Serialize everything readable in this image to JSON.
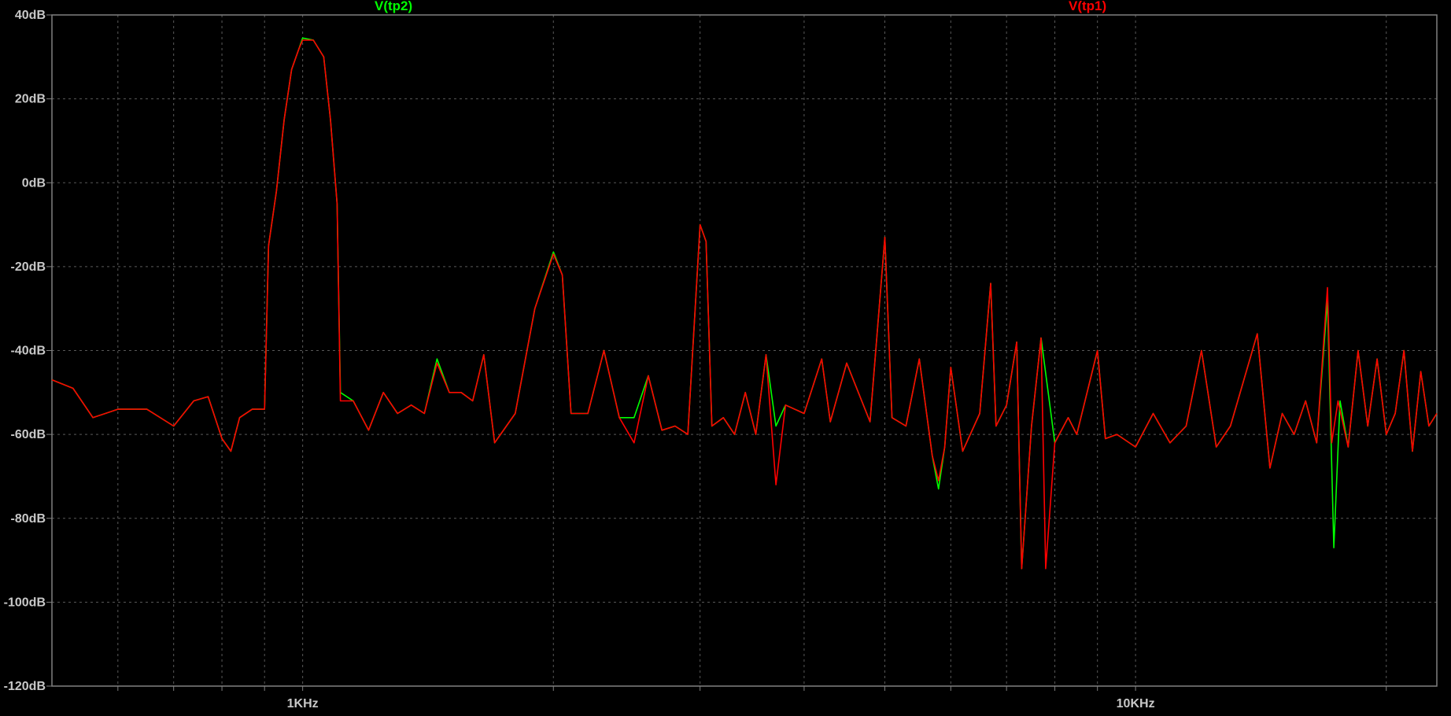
{
  "chart_data": {
    "type": "line",
    "xscale": "log",
    "xlim": [
      500,
      23000
    ],
    "ylim": [
      -120,
      40
    ],
    "grid": true,
    "y_ticks": [
      "40dB",
      "20dB",
      "0dB",
      "-20dB",
      "-40dB",
      "-60dB",
      "-80dB",
      "-100dB",
      "-120dB"
    ],
    "y_tick_values": [
      40,
      20,
      0,
      -20,
      -40,
      -60,
      -80,
      -100,
      -120
    ],
    "x_tick_labels": [
      "1KHz",
      "10KHz"
    ],
    "x_tick_values": [
      1000,
      10000
    ],
    "series": [
      {
        "name": "V(tp2)",
        "color": "#00ff00",
        "points": [
          [
            500,
            -47
          ],
          [
            530,
            -49
          ],
          [
            560,
            -56
          ],
          [
            600,
            -54
          ],
          [
            650,
            -54
          ],
          [
            700,
            -58
          ],
          [
            740,
            -52
          ],
          [
            770,
            -51
          ],
          [
            800,
            -61
          ],
          [
            820,
            -64
          ],
          [
            840,
            -56
          ],
          [
            870,
            -54
          ],
          [
            900,
            -54
          ],
          [
            910,
            -15
          ],
          [
            930,
            -2
          ],
          [
            950,
            15
          ],
          [
            970,
            27
          ],
          [
            990,
            32
          ],
          [
            1000,
            34.5
          ],
          [
            1030,
            34
          ],
          [
            1060,
            30
          ],
          [
            1080,
            15
          ],
          [
            1100,
            -5
          ],
          [
            1110,
            -50
          ],
          [
            1150,
            -52
          ],
          [
            1200,
            -59
          ],
          [
            1250,
            -50
          ],
          [
            1300,
            -55
          ],
          [
            1350,
            -53
          ],
          [
            1400,
            -55
          ],
          [
            1450,
            -42
          ],
          [
            1500,
            -50
          ],
          [
            1550,
            -50
          ],
          [
            1600,
            -52
          ],
          [
            1650,
            -41
          ],
          [
            1700,
            -62
          ],
          [
            1800,
            -55
          ],
          [
            1900,
            -30
          ],
          [
            2000,
            -16.5
          ],
          [
            2050,
            -22
          ],
          [
            2100,
            -55
          ],
          [
            2200,
            -55
          ],
          [
            2300,
            -40
          ],
          [
            2400,
            -56
          ],
          [
            2500,
            -56
          ],
          [
            2600,
            -46
          ],
          [
            2700,
            -59
          ],
          [
            2800,
            -58
          ],
          [
            2900,
            -60
          ],
          [
            3000,
            -10
          ],
          [
            3050,
            -14
          ],
          [
            3100,
            -58
          ],
          [
            3200,
            -56
          ],
          [
            3300,
            -60
          ],
          [
            3400,
            -50
          ],
          [
            3500,
            -60
          ],
          [
            3600,
            -41
          ],
          [
            3700,
            -58
          ],
          [
            3800,
            -53
          ],
          [
            4000,
            -55
          ],
          [
            4200,
            -42
          ],
          [
            4300,
            -57
          ],
          [
            4500,
            -43
          ],
          [
            4800,
            -57
          ],
          [
            5000,
            -13
          ],
          [
            5100,
            -56
          ],
          [
            5300,
            -58
          ],
          [
            5500,
            -42
          ],
          [
            5700,
            -65
          ],
          [
            5800,
            -73
          ],
          [
            5900,
            -63
          ],
          [
            6000,
            -44
          ],
          [
            6200,
            -64
          ],
          [
            6500,
            -55
          ],
          [
            6700,
            -24
          ],
          [
            6800,
            -58
          ],
          [
            7000,
            -53
          ],
          [
            7200,
            -38
          ],
          [
            7300,
            -92
          ],
          [
            7500,
            -58
          ],
          [
            7700,
            -37
          ],
          [
            8000,
            -62
          ],
          [
            8300,
            -56
          ],
          [
            8500,
            -60
          ],
          [
            9000,
            -40
          ],
          [
            9200,
            -61
          ],
          [
            9500,
            -60
          ],
          [
            10000,
            -63
          ],
          [
            10500,
            -55
          ],
          [
            11000,
            -62
          ],
          [
            11500,
            -58
          ],
          [
            12000,
            -40
          ],
          [
            12500,
            -63
          ],
          [
            13000,
            -58
          ],
          [
            14000,
            -36
          ],
          [
            14500,
            -68
          ],
          [
            15000,
            -55
          ],
          [
            15500,
            -60
          ],
          [
            16000,
            -52
          ],
          [
            16500,
            -62
          ],
          [
            17000,
            -28
          ],
          [
            17300,
            -87
          ],
          [
            17600,
            -52
          ],
          [
            18000,
            -63
          ],
          [
            18500,
            -40
          ],
          [
            19000,
            -58
          ],
          [
            19500,
            -42
          ],
          [
            20000,
            -60
          ],
          [
            20500,
            -55
          ],
          [
            21000,
            -40
          ],
          [
            21500,
            -64
          ],
          [
            22000,
            -45
          ],
          [
            22500,
            -58
          ],
          [
            23000,
            -55
          ]
        ]
      },
      {
        "name": "V(tp1)",
        "color": "#ff0000",
        "points": [
          [
            500,
            -47
          ],
          [
            530,
            -49
          ],
          [
            560,
            -56
          ],
          [
            600,
            -54
          ],
          [
            650,
            -54
          ],
          [
            700,
            -58
          ],
          [
            740,
            -52
          ],
          [
            770,
            -51
          ],
          [
            800,
            -61
          ],
          [
            820,
            -64
          ],
          [
            840,
            -56
          ],
          [
            870,
            -54
          ],
          [
            900,
            -54
          ],
          [
            910,
            -15
          ],
          [
            930,
            -2
          ],
          [
            950,
            15
          ],
          [
            970,
            27
          ],
          [
            990,
            32
          ],
          [
            1000,
            34
          ],
          [
            1030,
            34
          ],
          [
            1060,
            30
          ],
          [
            1080,
            15
          ],
          [
            1100,
            -5
          ],
          [
            1110,
            -52
          ],
          [
            1150,
            -52
          ],
          [
            1200,
            -59
          ],
          [
            1250,
            -50
          ],
          [
            1300,
            -55
          ],
          [
            1350,
            -53
          ],
          [
            1400,
            -55
          ],
          [
            1450,
            -43
          ],
          [
            1500,
            -50
          ],
          [
            1550,
            -50
          ],
          [
            1600,
            -52
          ],
          [
            1650,
            -41
          ],
          [
            1700,
            -62
          ],
          [
            1800,
            -55
          ],
          [
            1900,
            -30
          ],
          [
            2000,
            -17
          ],
          [
            2050,
            -22
          ],
          [
            2100,
            -55
          ],
          [
            2200,
            -55
          ],
          [
            2300,
            -40
          ],
          [
            2400,
            -56
          ],
          [
            2500,
            -62
          ],
          [
            2600,
            -46
          ],
          [
            2700,
            -59
          ],
          [
            2800,
            -58
          ],
          [
            2900,
            -60
          ],
          [
            3000,
            -10
          ],
          [
            3050,
            -14
          ],
          [
            3100,
            -58
          ],
          [
            3200,
            -56
          ],
          [
            3300,
            -60
          ],
          [
            3400,
            -50
          ],
          [
            3500,
            -60
          ],
          [
            3600,
            -41
          ],
          [
            3700,
            -72
          ],
          [
            3800,
            -53
          ],
          [
            4000,
            -55
          ],
          [
            4200,
            -42
          ],
          [
            4300,
            -57
          ],
          [
            4500,
            -43
          ],
          [
            4800,
            -57
          ],
          [
            5000,
            -13
          ],
          [
            5100,
            -56
          ],
          [
            5300,
            -58
          ],
          [
            5500,
            -42
          ],
          [
            5700,
            -65
          ],
          [
            5800,
            -71
          ],
          [
            5900,
            -63
          ],
          [
            6000,
            -44
          ],
          [
            6200,
            -64
          ],
          [
            6500,
            -55
          ],
          [
            6700,
            -24
          ],
          [
            6800,
            -58
          ],
          [
            7000,
            -53
          ],
          [
            7200,
            -38
          ],
          [
            7300,
            -92
          ],
          [
            7500,
            -58
          ],
          [
            7700,
            -37
          ],
          [
            7800,
            -92
          ],
          [
            8000,
            -62
          ],
          [
            8300,
            -56
          ],
          [
            8500,
            -60
          ],
          [
            9000,
            -40
          ],
          [
            9200,
            -61
          ],
          [
            9500,
            -60
          ],
          [
            10000,
            -63
          ],
          [
            10500,
            -55
          ],
          [
            11000,
            -62
          ],
          [
            11500,
            -58
          ],
          [
            12000,
            -40
          ],
          [
            12500,
            -63
          ],
          [
            13000,
            -58
          ],
          [
            14000,
            -36
          ],
          [
            14500,
            -68
          ],
          [
            15000,
            -55
          ],
          [
            15500,
            -60
          ],
          [
            16000,
            -52
          ],
          [
            16500,
            -62
          ],
          [
            17000,
            -25
          ],
          [
            17200,
            -62
          ],
          [
            17500,
            -52
          ],
          [
            18000,
            -63
          ],
          [
            18500,
            -40
          ],
          [
            19000,
            -58
          ],
          [
            19500,
            -42
          ],
          [
            20000,
            -60
          ],
          [
            20500,
            -55
          ],
          [
            21000,
            -40
          ],
          [
            21500,
            -64
          ],
          [
            22000,
            -45
          ],
          [
            22500,
            -58
          ],
          [
            23000,
            -55
          ]
        ]
      }
    ]
  },
  "colors": {
    "background": "#000000",
    "axis": "#808080",
    "grid": "#595959",
    "tick_text": "#c8c8c8"
  }
}
